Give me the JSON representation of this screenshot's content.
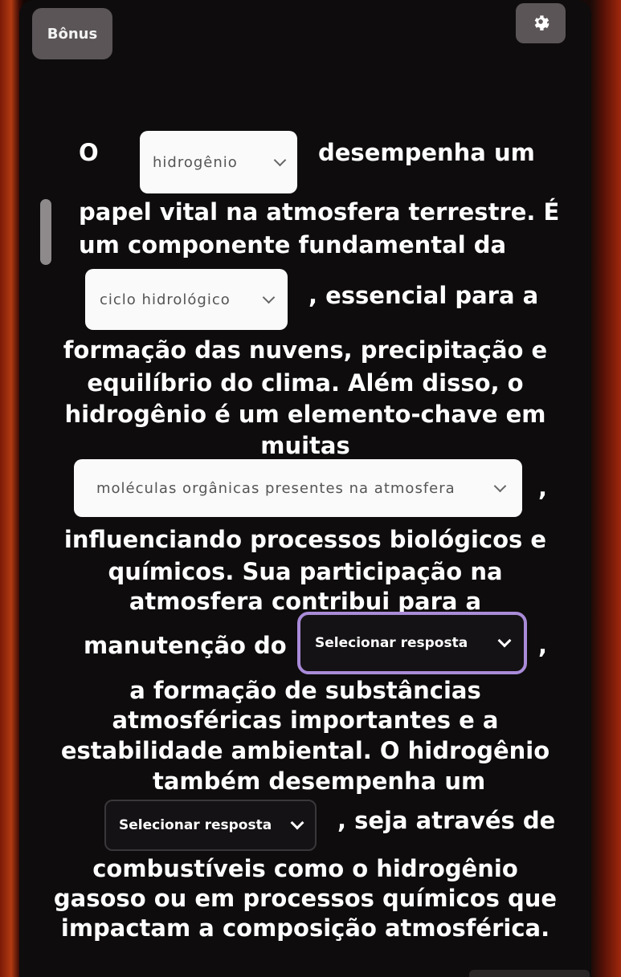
{
  "header": {
    "bonus_label": "Bônus",
    "settings_icon": "gear-icon"
  },
  "quiz": {
    "line1_prefix": "O",
    "dropdown1_value": "hidrogênio",
    "line1_suffix": "desempenha um",
    "line2": "papel vital na atmosfera terrestre. É",
    "line3": "um componente fundamental da",
    "dropdown2_value": "ciclo hidrológico",
    "line4_suffix": ", essencial para a",
    "line5": "formação das nuvens, precipitação e",
    "line6": "equilíbrio do clima. Além disso, o",
    "line7": "hidrogênio é um elemento-chave em",
    "line8": "muitas",
    "dropdown3_value": "moléculas orgânicas presentes na atmosfera",
    "line9_suffix": ",",
    "line10": "influenciando processos biológicos e",
    "line11": "químicos. Sua participação na",
    "line12": "atmosfera contribui para a",
    "line13_prefix": "manutenção do",
    "dropdown4_value": "Selecionar resposta",
    "line13_suffix": ",",
    "line14": "a formação de substâncias",
    "line15": "atmosféricas importantes e a",
    "line16": "estabilidade ambiental. O hidrogênio",
    "line17": "também desempenha um",
    "dropdown5_value": "Selecionar resposta",
    "line18_suffix": ", seja através de",
    "line19": "combustíveis como o hidrogênio",
    "line20": "gasoso ou em processos químicos que",
    "line21": "impactam a composição atmosférica."
  },
  "colors": {
    "background": "#0e0c0d",
    "button": "#5b5558",
    "focus_border": "#a98bd8"
  }
}
